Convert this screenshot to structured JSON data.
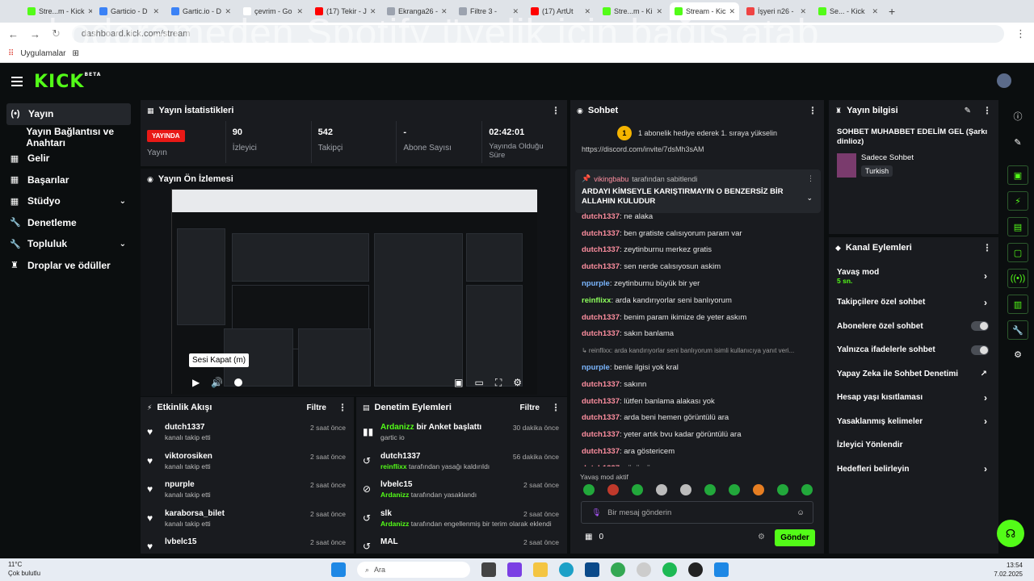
{
  "browser": {
    "tabs": [
      {
        "label": "Stre...m - Kick",
        "color": "#53fc18",
        "active": false
      },
      {
        "label": "Garticio - D",
        "color": "#3b82f6",
        "active": false
      },
      {
        "label": "Gartic.io - D",
        "color": "#3b82f6",
        "active": false
      },
      {
        "label": "çevrim - Go",
        "color": "#ffffff",
        "active": false
      },
      {
        "label": "(17) Tekir - J",
        "color": "#ff0000",
        "active": false
      },
      {
        "label": "Ekranga26 -",
        "color": "#9ca3af",
        "active": false
      },
      {
        "label": "Filtre 3 -",
        "color": "#9ca3af",
        "active": false
      },
      {
        "label": "(17) ArtUt",
        "color": "#ff0000",
        "active": false
      },
      {
        "label": "Stre...m - Ki",
        "color": "#53fc18",
        "active": false
      },
      {
        "label": "Stream - Kic",
        "color": "#53fc18",
        "active": true
      },
      {
        "label": "İşyeri n26 -",
        "color": "#ef4444",
        "active": false
      },
      {
        "label": "Se... - Kick",
        "color": "#53fc18",
        "active": false
      }
    ],
    "url": "dashboard.kick.com/stream",
    "bookmarks_label": "Uygulamalar",
    "overlay_text": "kodorameden Spotify üyelik için bağış atab"
  },
  "sidebar": {
    "items": [
      {
        "label": "Yayın",
        "icon": "(•)"
      },
      {
        "label": "Yayın Bağlantısı ve Anahtarı",
        "icon": ""
      },
      {
        "label": "Gelir",
        "icon": "▦"
      },
      {
        "label": "Başarılar",
        "icon": "▦"
      },
      {
        "label": "Stüdyo",
        "icon": "▦"
      },
      {
        "label": "Denetleme",
        "icon": "🔧"
      },
      {
        "label": "Topluluk",
        "icon": "🔧"
      },
      {
        "label": "Droplar ve ödüller",
        "icon": "♜"
      }
    ]
  },
  "stats": {
    "title": "Yayın İstatistikleri",
    "live_badge": "YAYINDA",
    "live_label": "Yayın",
    "viewers_value": "90",
    "viewers_label": "İzleyici",
    "followers_value": "542",
    "followers_label": "Takipçi",
    "subs_value": "-",
    "subs_label": "Abone Sayısı",
    "duration_value": "02:42:01",
    "duration_label": "Yayında Olduğu Süre"
  },
  "preview": {
    "title": "Yayın Ön İzlemesi",
    "tooltip": "Sesi Kapat (m)"
  },
  "activity": {
    "title": "Etkinlik Akışı",
    "filter": "Filtre",
    "items": [
      {
        "name": "dutch1337",
        "sub": "kanalı takip etti",
        "time": "2 saat önce"
      },
      {
        "name": "viktorosiken",
        "sub": "kanalı takip etti",
        "time": "2 saat önce"
      },
      {
        "name": "npurple",
        "sub": "kanalı takip etti",
        "time": "2 saat önce"
      },
      {
        "name": "karaborsa_bilet",
        "sub": "kanalı takip etti",
        "time": "2 saat önce"
      },
      {
        "name": "lvbelc15",
        "sub": "",
        "time": "2 saat önce"
      }
    ]
  },
  "moderation": {
    "title": "Denetim Eylemleri",
    "filter": "Filtre",
    "items": [
      {
        "actor": "Ardanizz",
        "name": "bir Anket başlattı",
        "sub": "gartic io",
        "time": "30 dakika önce",
        "icon": "▮▮"
      },
      {
        "actor": "",
        "name": "dutch1337",
        "sub_actor": "reinflixx",
        "sub": "tarafından yasağı kaldırıldı",
        "time": "56 dakika önce",
        "icon": "↺"
      },
      {
        "actor": "",
        "name": "lvbelc15",
        "sub_actor": "Ardanizz",
        "sub": "tarafından yasaklandı",
        "time": "2 saat önce",
        "icon": "⊘"
      },
      {
        "actor": "",
        "name": "slk",
        "sub_actor": "Ardanizz",
        "sub": "tarafından engellenmiş bir terim olarak eklendi",
        "time": "2 saat önce",
        "icon": "↺"
      },
      {
        "actor": "",
        "name": "MAL",
        "sub_actor": "",
        "sub": "",
        "time": "2 saat önce",
        "icon": "↺"
      }
    ]
  },
  "chat": {
    "title": "Sohbet",
    "gift_text": "1 abonelik hediye ederek 1. sıraya yükselin",
    "gift_rank": "1",
    "link_text": "https://discord.com/invite/7dsMh3sAM",
    "pinned_by": "vikingbabu",
    "pinned_by_suffix": "tarafından sabitlendi",
    "pinned_text": "ARDAYI KİMSEYLE KARIŞTIRMAYIN O BENZERSİZ BİR ALLAHIN KULUDUR",
    "messages": [
      {
        "user": "dutch1337",
        "cls": "u-red",
        "text": ": ne alaka"
      },
      {
        "user": "dutch1337",
        "cls": "u-red",
        "text": ": ben gratiste calısıyorum param var"
      },
      {
        "user": "dutch1337",
        "cls": "u-red",
        "text": ": zeytinburnu merkez gratis"
      },
      {
        "user": "dutch1337",
        "cls": "u-red",
        "text": ": sen nerde calısıyosun askim"
      },
      {
        "user": "npurple",
        "cls": "u-blue",
        "text": ": zeytinburnu büyük bir yer"
      },
      {
        "user": "reinflixx",
        "cls": "u-green",
        "text": ": arda kandırıyorlar seni banlıyorum"
      },
      {
        "user": "dutch1337",
        "cls": "u-red",
        "text": ": benim param ikimize de yeter askım"
      },
      {
        "user": "dutch1337",
        "cls": "u-red",
        "text": ": sakın banlama"
      },
      {
        "user": "",
        "cls": "",
        "text": "↳ reinflixx: arda kandırıyorlar seni banlıyorum isimli kullanıcıya yanıt veri..."
      },
      {
        "user": "npurple",
        "cls": "u-blue",
        "text": ": benle ilgisi yok kral"
      },
      {
        "user": "dutch1337",
        "cls": "u-red",
        "text": ": sakınn"
      },
      {
        "user": "dutch1337",
        "cls": "u-red",
        "text": ": lütfen banlama alakası yok"
      },
      {
        "user": "dutch1337",
        "cls": "u-red",
        "text": ": arda beni hemen görüntülü ara"
      },
      {
        "user": "dutch1337",
        "cls": "u-red",
        "text": ": yeter artık bvu kadar görüntülü ara"
      },
      {
        "user": "dutch1337",
        "cls": "u-red",
        "text": ": ara göstericem"
      },
      {
        "user": "dutch1337",
        "cls": "u-red",
        "text": ": yüzümü"
      }
    ],
    "slow_mode_notice": "Yavaş mod aktif",
    "input_placeholder": "Bir mesaj gönderin",
    "points": "0",
    "send_label": "Gönder"
  },
  "stream_info": {
    "title": "Yayın bilgisi",
    "stream_title": "SOHBET MUHABBET EDELİM GEL (Şarkı dinlioz)",
    "category": "Sadece Sohbet",
    "language": "Turkish"
  },
  "channel_actions": {
    "title": "Kanal Eylemleri",
    "items": [
      {
        "label": "Yavaş mod",
        "sub": "5 sn.",
        "control": "chevron"
      },
      {
        "label": "Takipçilere özel sohbet",
        "sub": "",
        "control": "chevron"
      },
      {
        "label": "Abonelere özel sohbet",
        "sub": "",
        "control": "toggle"
      },
      {
        "label": "Yalnızca ifadelerle sohbet",
        "sub": "",
        "control": "toggle"
      },
      {
        "label": "Yapay Zeka ile Sohbet Denetimi",
        "sub": "",
        "control": "external"
      },
      {
        "label": "Hesap yaşı kısıtlaması",
        "sub": "",
        "control": "chevron"
      },
      {
        "label": "Yasaklanmış kelimeler",
        "sub": "",
        "control": "chevron"
      },
      {
        "label": "İzleyici Yönlendir",
        "sub": "",
        "control": "none"
      },
      {
        "label": "Hedefleri belirleyin",
        "sub": "",
        "control": "chevron"
      }
    ]
  },
  "taskbar": {
    "temp": "11°C",
    "weather": "Çok bulutlu",
    "search": "Ara",
    "time": "13:54",
    "date": "7.02.2025"
  },
  "colors": {
    "accent": "#53fc18",
    "live": "#e91916",
    "panel": "#191b1f"
  }
}
